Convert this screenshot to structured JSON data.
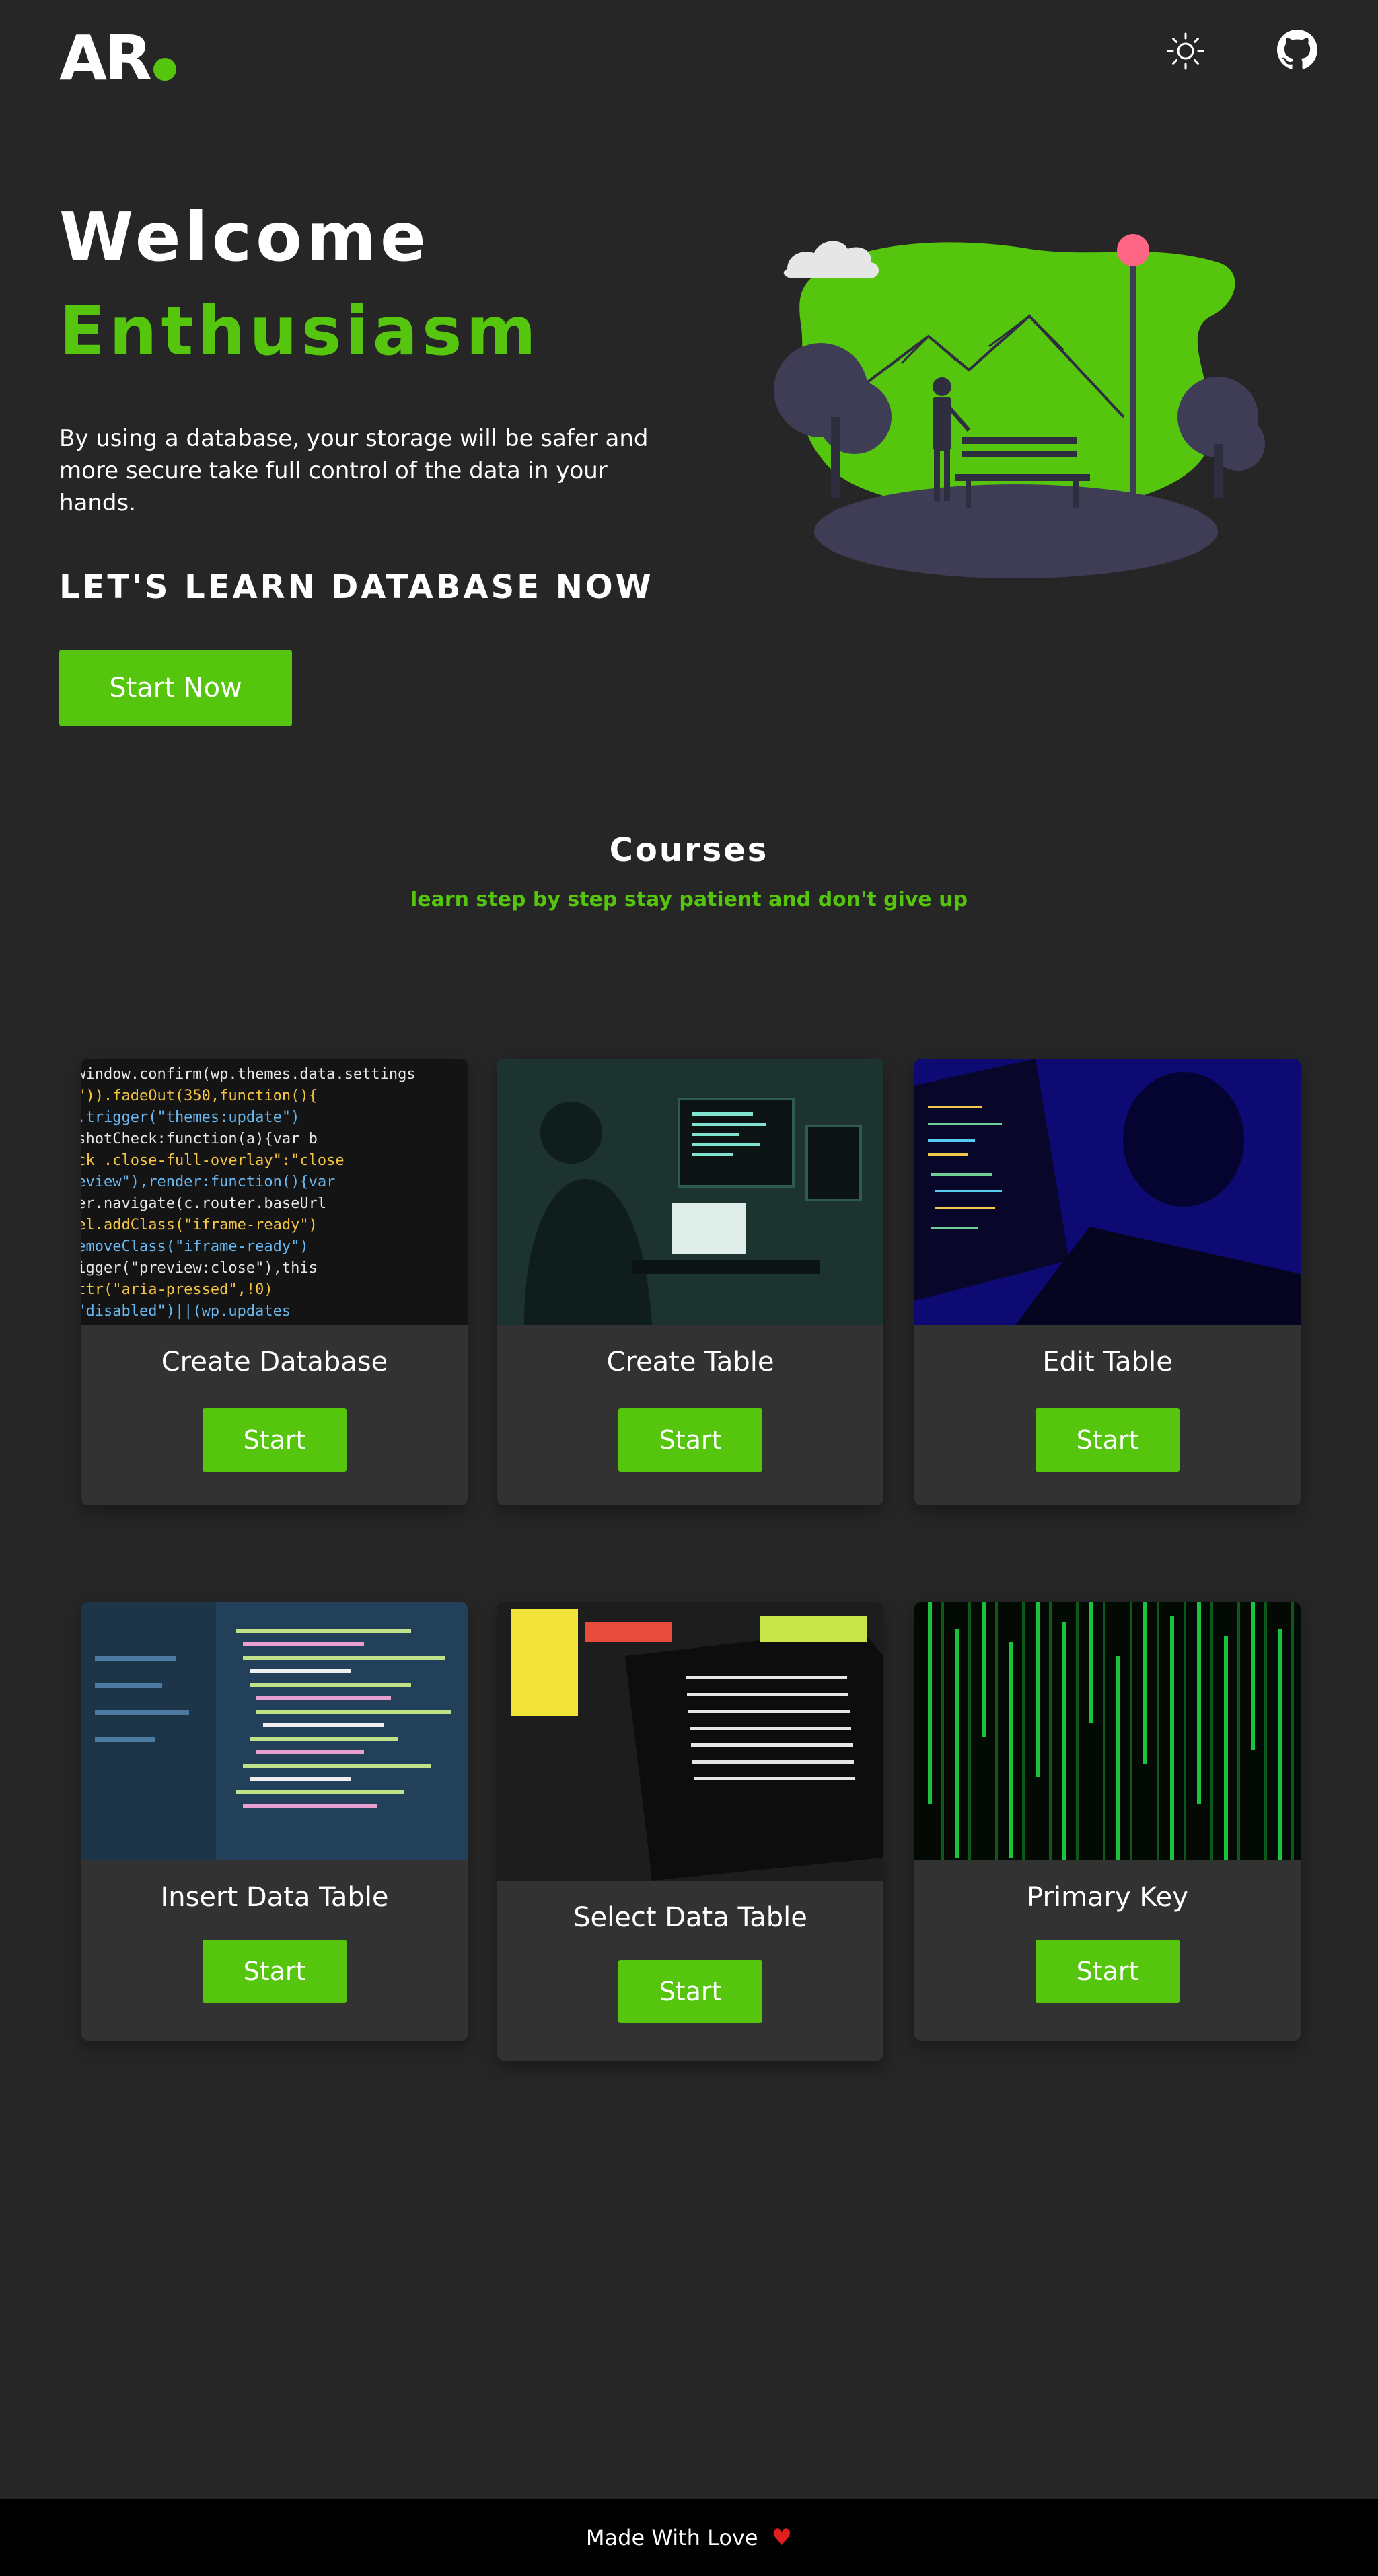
{
  "navbar": {
    "logo_text": "AR",
    "theme_icon": "sun-icon",
    "github_icon": "github-icon"
  },
  "hero": {
    "title": "Welcome",
    "subtitle": "Enthusiasm",
    "description": "By using a database, your storage will be safer and more secure take full control of the data in your hands.",
    "cta_text": "LET'S LEARN DATABASE NOW",
    "button_label": "Start Now"
  },
  "courses": {
    "title": "Courses",
    "subtitle": "learn step by step stay patient and don't give up",
    "items": [
      {
        "title": "Create Database",
        "button": "Start"
      },
      {
        "title": "Create Table",
        "button": "Start"
      },
      {
        "title": "Edit Table",
        "button": "Start"
      },
      {
        "title": "Insert Data Table",
        "button": "Start"
      },
      {
        "title": "Select Data Table",
        "button": "Start"
      },
      {
        "title": "Primary Key",
        "button": "Start"
      }
    ]
  },
  "footer": {
    "text": "Made With Love",
    "icon": "heart-icon"
  },
  "colors": {
    "background": "#262626",
    "accent": "#55c60d",
    "card": "#323232",
    "footer": "#000000"
  }
}
